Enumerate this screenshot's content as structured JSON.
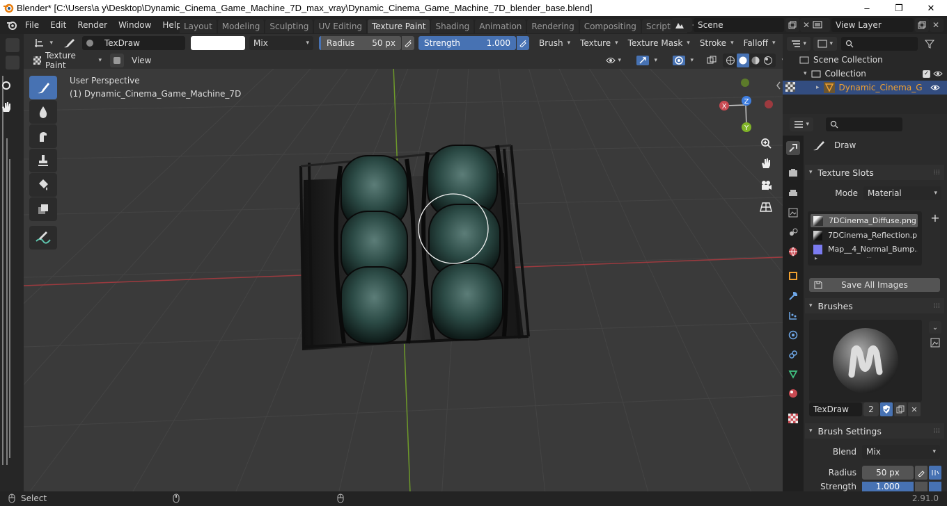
{
  "window": {
    "title": "Blender* [C:\\Users\\a y\\Desktop\\Dynamic_Cinema_Game_Machine_7D_max_vray\\Dynamic_Cinema_Game_Machine_7D_blender_base.blend]",
    "minimize": "–",
    "maximize": "❐",
    "close": "✕"
  },
  "menubar": {
    "items": [
      "File",
      "Edit",
      "Render",
      "Window",
      "Help"
    ]
  },
  "workspaces": {
    "tabs": [
      "Layout",
      "Modeling",
      "Sculpting",
      "UV Editing",
      "Texture Paint",
      "Shading",
      "Animation",
      "Rendering",
      "Compositing",
      "Scripting"
    ],
    "active": "Texture Paint",
    "add": "+"
  },
  "scene": {
    "name": "Scene"
  },
  "view_layer": {
    "name": "View Layer"
  },
  "tool_header": {
    "brush_name": "TexDraw",
    "blend_mode": "Mix",
    "radius_label": "Radius",
    "radius_value": "50 px",
    "strength_label": "Strength",
    "strength_value": "1.000",
    "strength_fraction": 1.0,
    "menus": [
      "Brush",
      "Texture",
      "Texture Mask",
      "Stroke",
      "Falloff"
    ]
  },
  "mode_header": {
    "mode": "Texture Paint",
    "view_menu": "View"
  },
  "viewport": {
    "perspective": "User Perspective",
    "object": "(1) Dynamic_Cinema_Game_Machine_7D",
    "gizmo": {
      "x": "X",
      "y": "Y",
      "z": "Z"
    },
    "accent_colors": {
      "x_axis": "#c84a52",
      "y_axis": "#80b428",
      "z_axis": "#3f7ee0"
    }
  },
  "outliner": {
    "scene_collection": "Scene Collection",
    "collection": "Collection",
    "object": "Dynamic_Cinema_G"
  },
  "properties": {
    "tool_name": "Draw",
    "texture_slots": {
      "header": "Texture Slots",
      "mode_label": "Mode",
      "mode_value": "Material",
      "slots": [
        "7DCinema_Diffuse.png",
        "7DCinema_Reflection.p...",
        "Map__4_Normal_Bump...."
      ],
      "save_all": "Save All Images"
    },
    "brushes": {
      "header": "Brushes",
      "brush_name": "TexDraw",
      "user_count": "2"
    },
    "brush_settings": {
      "header": "Brush Settings",
      "blend_label": "Blend",
      "blend_value": "Mix",
      "radius_label": "Radius",
      "radius_value": "50 px",
      "strength_label": "Strength",
      "strength_value": "1.000"
    }
  },
  "statusbar": {
    "select": "Select",
    "version": "2.91.0"
  }
}
